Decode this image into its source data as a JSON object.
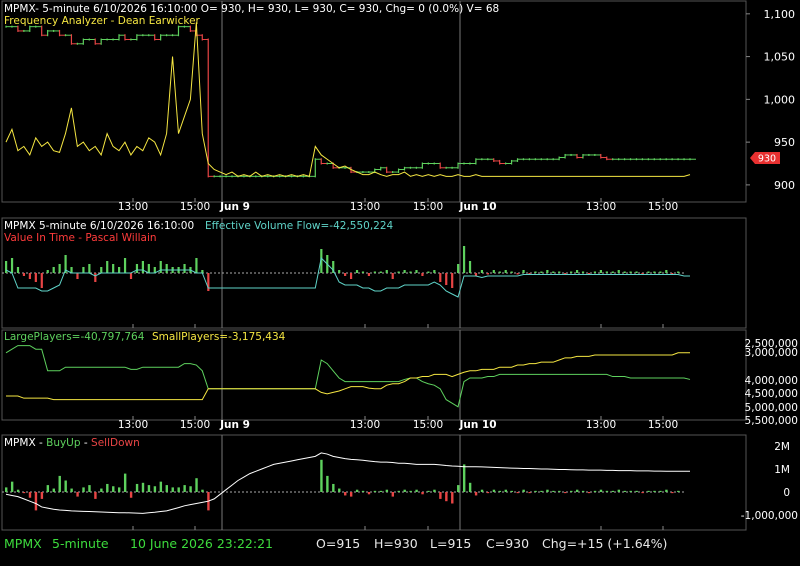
{
  "colors": {
    "background": "#000000",
    "grid": "#3a3a3a",
    "axis_text": "#ffffff",
    "up": "#5ed15e",
    "down": "#e84545",
    "yellow": "#f5e642",
    "cyan": "#5fd3c8",
    "red_label": "#ff3b3b",
    "status_green": "#3ddc3d",
    "status_white": "#e8e8e8"
  },
  "panes": {
    "price": {
      "header": "MPMX- 5-minute 6/10/2026 16:10:00 O= 930, H= 930, L= 930, C= 930, Chg= 0 (0.0%) V= 68",
      "indicator": "Frequency Analyzer - Dean Earwicker",
      "price_badge": "930"
    },
    "flow": {
      "header_symbol": "MPMX 5-minute  6/10/2026 16:10:00",
      "header_indicator": "Effective Volume Flow=-42,550,224",
      "indicator2": "Value In Time - Pascal Willain"
    },
    "players": {
      "large_label": "LargePlayers=-40,797,764",
      "small_label": "SmallPlayers=-3,175,434"
    },
    "buyup": {
      "symbol_label": "MPMX - ",
      "buyup_label": "BuyUp",
      "dash": "-",
      "selldown_label": "SellDown"
    }
  },
  "status_bar": {
    "symbol": "MPMX",
    "interval": "5-minute",
    "datetime": "10 June 2026 23:22:21",
    "open": "O=915",
    "high": "H=930",
    "low": "L=915",
    "close": "C=930",
    "change": "Chg=+15 (+1.64%)"
  },
  "chart_data": [
    {
      "type": "line",
      "title": "Frequency Analyzer - Dean Earwicker",
      "xaxis_ticks": [
        "13:00",
        "15:00",
        "Jun 9",
        "13:00",
        "15:00",
        "Jun 10",
        "13:00",
        "15:00"
      ],
      "yaxis_ticks": [
        "1,100",
        "1,050",
        "1,000",
        "950",
        "900"
      ],
      "ylim": [
        880,
        1115
      ],
      "series": [
        {
          "name": "MPMX",
          "values": [
            1085,
            1085,
            1080,
            1080,
            1085,
            1085,
            1075,
            1080,
            1080,
            1075,
            1075,
            1065,
            1065,
            1070,
            1070,
            1065,
            1070,
            1070,
            1070,
            1075,
            1070,
            1070,
            1075,
            1075,
            1075,
            1070,
            1075,
            1075,
            1075,
            1085,
            1085,
            1080,
            1075,
            1070,
            910,
            910,
            910,
            910,
            910,
            910,
            910,
            910,
            910,
            910,
            910,
            910,
            910,
            910,
            910,
            910,
            910,
            910,
            930,
            925,
            925,
            920,
            920,
            920,
            915,
            915,
            915,
            915,
            918,
            920,
            915,
            915,
            918,
            920,
            920,
            920,
            925,
            925,
            925,
            920,
            920,
            920,
            925,
            925,
            925,
            930,
            930,
            930,
            928,
            925,
            925,
            928,
            930,
            930,
            930,
            930,
            930,
            930,
            930,
            932,
            935,
            935,
            932,
            935,
            935,
            935,
            932,
            930,
            930,
            930,
            930,
            930,
            930,
            930,
            930,
            930,
            930,
            930,
            930,
            930,
            930,
            930
          ]
        },
        {
          "name": "Frequency Analyzer",
          "values": [
            950,
            965,
            940,
            945,
            935,
            955,
            945,
            950,
            940,
            938,
            960,
            990,
            945,
            950,
            940,
            945,
            935,
            960,
            945,
            940,
            950,
            935,
            945,
            940,
            955,
            950,
            935,
            960,
            1050,
            960,
            980,
            1000,
            1090,
            960,
            925,
            918,
            915,
            912,
            915,
            910,
            912,
            910,
            915,
            910,
            912,
            910,
            912,
            910,
            912,
            910,
            912,
            910,
            945,
            935,
            930,
            925,
            920,
            922,
            918,
            915,
            912,
            912,
            915,
            912,
            910,
            912,
            912,
            915,
            910,
            912,
            910,
            912,
            910,
            912,
            910,
            910,
            912,
            910,
            910,
            912,
            910,
            910,
            910,
            910,
            910,
            910,
            910,
            910,
            910,
            910,
            910,
            910,
            910,
            910,
            910,
            910,
            910,
            910,
            910,
            910,
            910,
            910,
            910,
            910,
            910,
            910,
            910,
            910,
            910,
            910,
            910,
            910,
            910,
            910,
            910,
            912
          ]
        }
      ]
    },
    {
      "type": "bar",
      "title": "Effective Volume Flow",
      "series": [
        {
          "name": "Effective Volume Flow",
          "values": [
            0.4,
            0.5,
            0.2,
            -0.1,
            -0.2,
            -0.3,
            -0.5,
            0.1,
            0.2,
            0.3,
            0.6,
            0.2,
            -0.2,
            0.2,
            0.3,
            -0.3,
            0.2,
            0.4,
            0.3,
            0.2,
            0.5,
            -0.2,
            0.3,
            0.4,
            0.3,
            0.2,
            0.4,
            0.3,
            0.2,
            0.2,
            0.3,
            0.2,
            0.5,
            0.1,
            -0.6,
            0,
            0,
            0,
            0,
            0,
            0,
            0,
            0,
            0,
            0,
            0,
            0,
            0,
            0,
            0,
            0,
            0,
            0,
            0.8,
            0.6,
            0.4,
            0.1,
            -0.1,
            -0.2,
            0.1,
            0.05,
            -0.1,
            0.05,
            0.05,
            0.1,
            -0.2,
            0.05,
            0.1,
            0.05,
            0.1,
            -0.1,
            0.05,
            0.1,
            -0.3,
            -0.4,
            -0.5,
            0.3,
            0.9,
            0.4,
            -0.1,
            0.1,
            -0.05,
            0.1,
            0.05,
            0.1,
            0.05,
            -0.05,
            0.1,
            -0.05,
            0.05,
            0.05,
            0.1,
            0.05,
            0.05,
            -0.05,
            0.05,
            0.1,
            0.05,
            -0.05,
            0.05,
            0.1,
            0.05,
            0.05,
            0.1,
            0.05,
            0.05,
            0.05,
            -0.05,
            0.05,
            0.05,
            0.05,
            0.1,
            -0.05,
            0.05
          ]
        },
        {
          "name": "Value In Time",
          "values": [
            0.1,
            0.0,
            -0.5,
            -0.5,
            -0.5,
            -0.5,
            -0.6,
            -0.6,
            -0.5,
            -0.4,
            0.1,
            0.0,
            0.0,
            0.0,
            0.0,
            -0.1,
            0.0,
            0.0,
            0.0,
            0.0,
            0.0,
            0.0,
            0.1,
            0.1,
            0.0,
            0.0,
            0.1,
            0.1,
            0.1,
            0.1,
            0.1,
            0.1,
            0.0,
            0.0,
            -0.5,
            -0.5,
            -0.5,
            -0.5,
            -0.5,
            -0.5,
            -0.5,
            -0.5,
            -0.5,
            -0.5,
            -0.5,
            -0.5,
            -0.5,
            -0.5,
            -0.5,
            -0.5,
            -0.5,
            -0.5,
            -0.5,
            0.5,
            0.3,
            0.1,
            -0.3,
            -0.4,
            -0.4,
            -0.4,
            -0.5,
            -0.5,
            -0.6,
            -0.6,
            -0.5,
            -0.5,
            -0.5,
            -0.4,
            -0.4,
            -0.4,
            -0.4,
            -0.4,
            -0.3,
            -0.4,
            -0.6,
            -0.7,
            -0.8,
            -0.1,
            -0.1,
            -0.1,
            -0.15,
            -0.1,
            -0.1,
            -0.1,
            -0.1,
            -0.1,
            -0.1,
            -0.05,
            -0.05,
            -0.05,
            -0.05,
            -0.05,
            -0.05,
            -0.05,
            -0.05,
            -0.05,
            -0.05,
            -0.05,
            -0.05,
            -0.05,
            -0.05,
            -0.05,
            -0.05,
            -0.05,
            -0.05,
            -0.05,
            -0.05,
            -0.05,
            -0.05,
            -0.05,
            -0.05,
            -0.05,
            -0.05,
            -0.05,
            -0.1,
            -0.1
          ]
        }
      ]
    },
    {
      "type": "line",
      "title": "LargePlayers / SmallPlayers",
      "xaxis_ticks": [
        "13:00",
        "15:00",
        "Jun 9",
        "13:00",
        "15:00",
        "Jun 10",
        "13:00",
        "15:00"
      ],
      "yaxis_ticks": [
        "2,500,000",
        "3,000,000",
        "4,000,000",
        "4,500,000",
        "5,000,000",
        "5,500,000"
      ],
      "series": [
        {
          "name": "LargePlayers",
          "values": [
            0.85,
            0.9,
            0.95,
            0.95,
            0.95,
            0.9,
            0.9,
            0.6,
            0.6,
            0.6,
            0.65,
            0.65,
            0.65,
            0.65,
            0.65,
            0.65,
            0.65,
            0.65,
            0.65,
            0.65,
            0.65,
            0.62,
            0.62,
            0.65,
            0.65,
            0.65,
            0.65,
            0.65,
            0.65,
            0.65,
            0.7,
            0.7,
            0.68,
            0.6,
            0.35,
            0.35,
            0.35,
            0.35,
            0.35,
            0.35,
            0.35,
            0.35,
            0.35,
            0.35,
            0.35,
            0.35,
            0.35,
            0.35,
            0.35,
            0.35,
            0.35,
            0.35,
            0.35,
            0.75,
            0.7,
            0.6,
            0.5,
            0.45,
            0.45,
            0.45,
            0.45,
            0.45,
            0.45,
            0.45,
            0.45,
            0.45,
            0.45,
            0.48,
            0.5,
            0.5,
            0.45,
            0.42,
            0.4,
            0.35,
            0.2,
            0.15,
            0.1,
            0.45,
            0.5,
            0.5,
            0.5,
            0.52,
            0.52,
            0.55,
            0.55,
            0.55,
            0.55,
            0.55,
            0.55,
            0.55,
            0.55,
            0.55,
            0.55,
            0.55,
            0.55,
            0.55,
            0.55,
            0.55,
            0.55,
            0.55,
            0.55,
            0.55,
            0.52,
            0.52,
            0.52,
            0.5,
            0.5,
            0.5,
            0.5,
            0.5,
            0.5,
            0.5,
            0.5,
            0.5,
            0.5,
            0.48
          ]
        },
        {
          "name": "SmallPlayers",
          "values": [
            0.25,
            0.25,
            0.25,
            0.22,
            0.22,
            0.22,
            0.22,
            0.22,
            0.2,
            0.2,
            0.2,
            0.2,
            0.2,
            0.2,
            0.2,
            0.2,
            0.2,
            0.2,
            0.2,
            0.2,
            0.2,
            0.2,
            0.2,
            0.2,
            0.2,
            0.2,
            0.2,
            0.2,
            0.2,
            0.2,
            0.2,
            0.2,
            0.2,
            0.2,
            0.35,
            0.35,
            0.35,
            0.35,
            0.35,
            0.35,
            0.35,
            0.35,
            0.35,
            0.35,
            0.35,
            0.35,
            0.35,
            0.35,
            0.35,
            0.35,
            0.35,
            0.35,
            0.35,
            0.3,
            0.28,
            0.3,
            0.32,
            0.35,
            0.38,
            0.38,
            0.38,
            0.36,
            0.35,
            0.35,
            0.4,
            0.42,
            0.42,
            0.45,
            0.5,
            0.5,
            0.52,
            0.52,
            0.55,
            0.55,
            0.55,
            0.52,
            0.55,
            0.58,
            0.6,
            0.6,
            0.62,
            0.62,
            0.62,
            0.65,
            0.65,
            0.65,
            0.68,
            0.68,
            0.7,
            0.7,
            0.72,
            0.72,
            0.72,
            0.75,
            0.78,
            0.78,
            0.8,
            0.8,
            0.8,
            0.82,
            0.82,
            0.82,
            0.82,
            0.82,
            0.82,
            0.82,
            0.82,
            0.82,
            0.82,
            0.82,
            0.82,
            0.82,
            0.82,
            0.85,
            0.85,
            0.85
          ]
        }
      ]
    },
    {
      "type": "bar",
      "title": "MPMX - BuyUp-SellDown",
      "yaxis_ticks": [
        "2M",
        "1M",
        "0",
        "-1,000,000"
      ],
      "ylim": [
        -1600000,
        2400000
      ],
      "series": [
        {
          "name": "BuyUp-SellDown",
          "values": [
            200000,
            450000,
            100000,
            -50000,
            -250000,
            -800000,
            -300000,
            300000,
            150000,
            700000,
            500000,
            150000,
            -200000,
            200000,
            300000,
            -300000,
            150000,
            350000,
            250000,
            200000,
            800000,
            -250000,
            350000,
            400000,
            300000,
            250000,
            450000,
            300000,
            200000,
            200000,
            300000,
            250000,
            600000,
            100000,
            -800000,
            0,
            0,
            0,
            0,
            0,
            0,
            0,
            0,
            0,
            0,
            0,
            0,
            0,
            0,
            0,
            0,
            0,
            0,
            1400000,
            700000,
            350000,
            150000,
            -150000,
            -200000,
            100000,
            50000,
            -100000,
            50000,
            50000,
            100000,
            -200000,
            50000,
            100000,
            50000,
            100000,
            -100000,
            50000,
            100000,
            -300000,
            -400000,
            -500000,
            300000,
            1200000,
            400000,
            -150000,
            100000,
            -50000,
            100000,
            50000,
            100000,
            50000,
            -50000,
            100000,
            -50000,
            50000,
            50000,
            100000,
            50000,
            50000,
            -50000,
            50000,
            100000,
            50000,
            -50000,
            50000,
            100000,
            50000,
            50000,
            100000,
            50000,
            50000,
            50000,
            -50000,
            50000,
            50000,
            50000,
            100000,
            -50000,
            50000
          ]
        },
        {
          "name": "Cumulative",
          "values": [
            -100000,
            -150000,
            -200000,
            -300000,
            -400000,
            -500000,
            -650000,
            -700000,
            -750000,
            -780000,
            -800000,
            -820000,
            -830000,
            -840000,
            -850000,
            -860000,
            -870000,
            -880000,
            -890000,
            -900000,
            -900000,
            -910000,
            -920000,
            -930000,
            -900000,
            -880000,
            -850000,
            -820000,
            -750000,
            -680000,
            -600000,
            -550000,
            -500000,
            -450000,
            -400000,
            -300000,
            -100000,
            100000,
            300000,
            500000,
            650000,
            800000,
            900000,
            1000000,
            1100000,
            1200000,
            1250000,
            1300000,
            1350000,
            1400000,
            1450000,
            1500000,
            1550000,
            1700000,
            1650000,
            1550000,
            1500000,
            1450000,
            1420000,
            1400000,
            1380000,
            1350000,
            1320000,
            1300000,
            1300000,
            1280000,
            1250000,
            1250000,
            1230000,
            1200000,
            1200000,
            1200000,
            1200000,
            1180000,
            1150000,
            1130000,
            1120000,
            1100000,
            1100000,
            1100000,
            1090000,
            1080000,
            1070000,
            1060000,
            1050000,
            1040000,
            1030000,
            1020000,
            1020000,
            1010000,
            1000000,
            1000000,
            990000,
            980000,
            980000,
            970000,
            960000,
            960000,
            950000,
            950000,
            950000,
            940000,
            940000,
            930000,
            930000,
            930000,
            920000,
            920000,
            920000,
            910000,
            910000,
            900000,
            900000,
            900000,
            900000,
            900000
          ]
        }
      ]
    }
  ]
}
